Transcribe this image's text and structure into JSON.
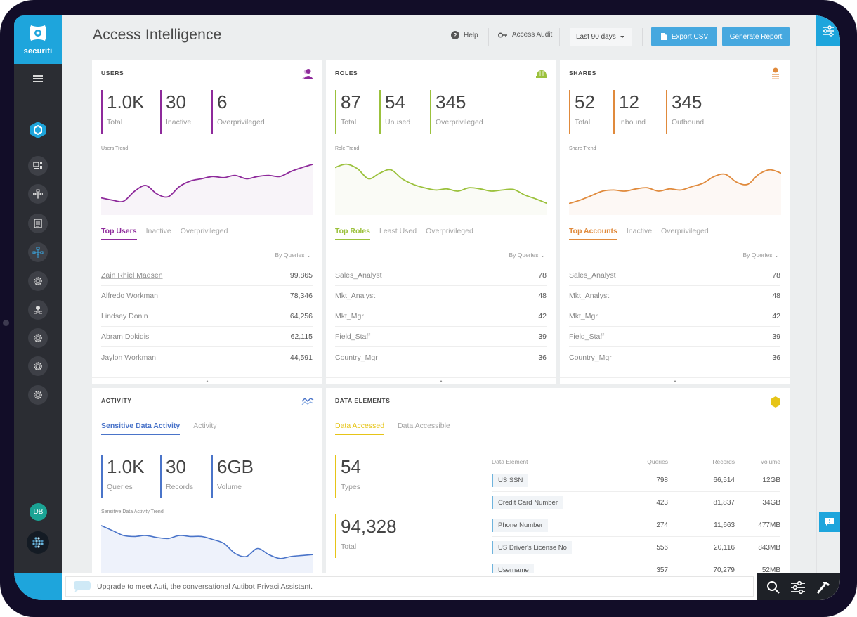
{
  "app": {
    "brand": "securiti",
    "page_title": "Access Intelligence"
  },
  "header": {
    "help": "Help",
    "access_audit": "Access Audit",
    "range": "Last 90 days",
    "export_csv": "Export CSV",
    "generate_report": "Generate Report"
  },
  "sidebar": {
    "icons": [
      "hexagon-logo-icon",
      "dashboard-icon",
      "network-icon",
      "checklist-icon",
      "topology-icon",
      "gear-icon",
      "integration-icon",
      "gear-icon",
      "gear-icon",
      "gear-icon"
    ],
    "avatar_initials": "DB"
  },
  "colors": {
    "users": "#8e2a9b",
    "roles": "#9bc13c",
    "shares": "#e08a3c",
    "activity": "#4a74c9",
    "data_elements": "#e6c417",
    "brand": "#1ea5dc"
  },
  "users": {
    "title": "USERS",
    "stats": [
      {
        "value": "1.0K",
        "label": "Total"
      },
      {
        "value": "30",
        "label": "Inactive"
      },
      {
        "value": "6",
        "label": "Overprivileged"
      }
    ],
    "trend_label": "Users Trend",
    "trend": [
      0.28,
      0.24,
      0.22,
      0.4,
      0.5,
      0.35,
      0.3,
      0.48,
      0.58,
      0.62,
      0.66,
      0.64,
      0.68,
      0.62,
      0.66,
      0.68,
      0.66,
      0.75,
      0.82,
      0.88
    ],
    "tabs": [
      "Top Users",
      "Inactive",
      "Overprivileged"
    ],
    "sort": "By Queries",
    "rows": [
      {
        "name": "Zain Rhiel Madsen",
        "value": "99,865"
      },
      {
        "name": "Alfredo Workman",
        "value": "78,346"
      },
      {
        "name": "Lindsey Donin",
        "value": "64,256"
      },
      {
        "name": "Abram Dokidis",
        "value": "62,115"
      },
      {
        "name": "Jaylon Workman",
        "value": "44,591"
      }
    ]
  },
  "roles": {
    "title": "ROLES",
    "stats": [
      {
        "value": "87",
        "label": "Total"
      },
      {
        "value": "54",
        "label": "Unused"
      },
      {
        "value": "345",
        "label": "Overprivileged"
      }
    ],
    "trend_label": "Role Trend",
    "trend": [
      0.82,
      0.88,
      0.8,
      0.62,
      0.72,
      0.78,
      0.62,
      0.52,
      0.46,
      0.42,
      0.44,
      0.4,
      0.46,
      0.44,
      0.4,
      0.42,
      0.43,
      0.33,
      0.26,
      0.18
    ],
    "tabs": [
      "Top Roles",
      "Least Used",
      "Overprivileged"
    ],
    "sort": "By Queries",
    "rows": [
      {
        "name": "Sales_Analyst",
        "value": "78"
      },
      {
        "name": "Mkt_Analyst",
        "value": "48"
      },
      {
        "name": "Mkt_Mgr",
        "value": "42"
      },
      {
        "name": "Field_Staff",
        "value": "39"
      },
      {
        "name": "Country_Mgr",
        "value": "36"
      }
    ]
  },
  "shares": {
    "title": "SHARES",
    "stats": [
      {
        "value": "52",
        "label": "Total"
      },
      {
        "value": "12",
        "label": "Inbound"
      },
      {
        "value": "345",
        "label": "Outbound"
      }
    ],
    "trend_label": "Share Trend",
    "trend": [
      0.18,
      0.24,
      0.32,
      0.4,
      0.42,
      0.4,
      0.44,
      0.46,
      0.4,
      0.44,
      0.42,
      0.48,
      0.54,
      0.66,
      0.7,
      0.56,
      0.52,
      0.7,
      0.78,
      0.72
    ],
    "tabs": [
      "Top Accounts",
      "Inactive",
      "Overprivileged"
    ],
    "sort": "By Queries",
    "rows": [
      {
        "name": "Sales_Analyst",
        "value": "78"
      },
      {
        "name": "Mkt_Analyst",
        "value": "48"
      },
      {
        "name": "Mkt_Mgr",
        "value": "42"
      },
      {
        "name": "Field_Staff",
        "value": "39"
      },
      {
        "name": "Country_Mgr",
        "value": "36"
      }
    ]
  },
  "activity": {
    "title": "ACTIVITY",
    "tabs": [
      "Sensitive Data Activity",
      "Activity"
    ],
    "stats": [
      {
        "value": "1.0K",
        "label": "Queries"
      },
      {
        "value": "30",
        "label": "Records"
      },
      {
        "value": "6GB",
        "label": "Volume"
      }
    ],
    "trend_label": "Sensitive Data Activity Trend",
    "trend": [
      0.92,
      0.82,
      0.72,
      0.7,
      0.72,
      0.68,
      0.66,
      0.72,
      0.7,
      0.7,
      0.64,
      0.56,
      0.36,
      0.3,
      0.46,
      0.34,
      0.26,
      0.3,
      0.32,
      0.34
    ]
  },
  "data_elements": {
    "title": "DATA ELEMENTS",
    "tabs": [
      "Data Accessed",
      "Data Accessible"
    ],
    "stats": [
      {
        "value": "54",
        "label": "Types"
      },
      {
        "value": "94,328",
        "label": "Total"
      }
    ],
    "columns": [
      "Data Element",
      "Queries",
      "Records",
      "Volume"
    ],
    "rows": [
      {
        "name": "US SSN",
        "queries": "798",
        "records": "66,514",
        "volume": "12GB"
      },
      {
        "name": "Credit Card Number",
        "queries": "423",
        "records": "81,837",
        "volume": "34GB"
      },
      {
        "name": "Phone Number",
        "queries": "274",
        "records": "11,663",
        "volume": "477MB"
      },
      {
        "name": "US Driver's License No",
        "queries": "556",
        "records": "20,116",
        "volume": "843MB"
      },
      {
        "name": "Username",
        "queries": "357",
        "records": "70,279",
        "volume": "52MB"
      }
    ]
  },
  "assistant": {
    "text": "Upgrade to meet Auti, the conversational Autibot Privaci Assistant."
  }
}
